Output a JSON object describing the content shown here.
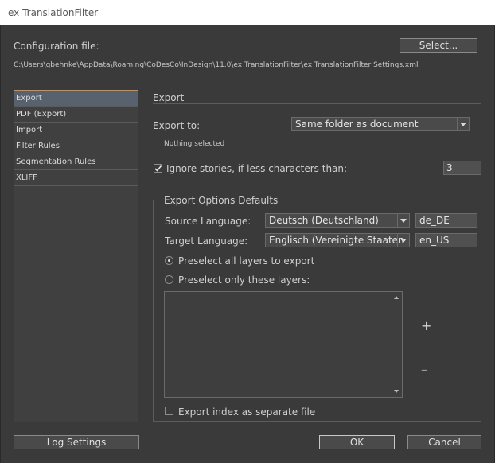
{
  "window": {
    "title": "ex TranslationFilter"
  },
  "config": {
    "label": "Configuration file:",
    "select_label": "Select...",
    "path": "C:\\Users\\gbehnke\\AppData\\Roaming\\CoDesCo\\InDesign\\11.0\\ex TranslationFilter\\ex TranslationFilter Settings.xml"
  },
  "sidebar": {
    "items": [
      {
        "label": "Export",
        "selected": true
      },
      {
        "label": "PDF (Export)"
      },
      {
        "label": "Import"
      },
      {
        "label": "Filter Rules"
      },
      {
        "label": "Segmentation Rules"
      },
      {
        "label": "XLIFF"
      }
    ]
  },
  "export": {
    "heading": "Export",
    "export_to_label": "Export to:",
    "export_to_value": "Same folder as document",
    "nothing_selected": "Nothing selected",
    "ignore_label": "Ignore stories, if less characters than:",
    "ignore_checked": true,
    "ignore_value": "3"
  },
  "defaults": {
    "legend": "Export Options Defaults",
    "source_label": "Source Language:",
    "source_value": "Deutsch (Deutschland)",
    "source_code": "de_DE",
    "target_label": "Target Language:",
    "target_value": "Englisch (Vereinigte Staaten",
    "target_code": "en_US",
    "radio_all": "Preselect all layers to export",
    "radio_only": "Preselect only these layers:",
    "add_symbol": "+",
    "remove_symbol": "–",
    "index_label": "Export index as separate file"
  },
  "footer": {
    "log_settings": "Log Settings",
    "ok": "OK",
    "cancel": "Cancel"
  }
}
